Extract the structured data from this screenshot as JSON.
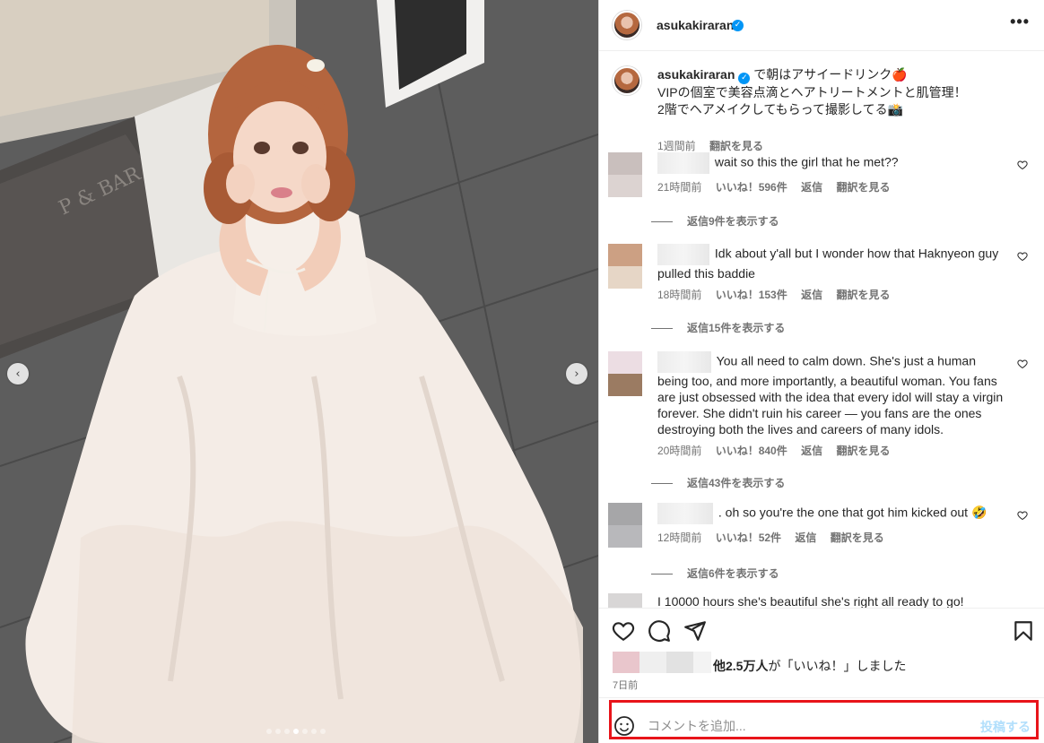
{
  "post": {
    "username": "asukakiraran",
    "verified_badge": "✓",
    "more_icon": "•••",
    "photo_nav": {
      "prev_icon": "‹",
      "next_icon": "›",
      "dot_count": 7,
      "active_dot": 3
    }
  },
  "caption": {
    "username": "asukakiraran",
    "lines": [
      "で朝はアサイードリンク🍎",
      "VIPの個室で美容点滴とヘアトリートメントと肌管理！",
      "2階でヘアメイクしてもらって撮影してる📸"
    ],
    "time": "1週間前",
    "translate": "翻訳を見る"
  },
  "comments": [
    {
      "text": "wait so this the girl that he met??",
      "time": "21時間前",
      "likes": "いいね！596件",
      "reply": "返信",
      "translate": "翻訳を見る",
      "view_replies": "返信9件を表示する"
    },
    {
      "text": "Idk about y'all but I wonder how that Haknyeon guy pulled this baddie",
      "time": "18時間前",
      "likes": "いいね！153件",
      "reply": "返信",
      "translate": "翻訳を見る",
      "view_replies": "返信15件を表示する"
    },
    {
      "text": "You all need to calm down. She's just a human being too, and more importantly, a beautiful woman. You fans are just obsessed with the idea that every idol will stay a virgin forever. She didn't ruin his career — you fans are the ones destroying both the lives and careers of many idols.",
      "time": "20時間前",
      "likes": "いいね！840件",
      "reply": "返信",
      "translate": "翻訳を見る",
      "view_replies": "返信43件を表示する"
    },
    {
      "text": ". oh so you're the one that got him kicked out 🤣",
      "time": "12時間前",
      "likes": "いいね！52件",
      "reply": "返信",
      "translate": "翻訳を見る",
      "view_replies": "返信6件を表示する"
    },
    {
      "text": "I 10000 hours she's beautiful she's right all ready to go!"
    }
  ],
  "actions": {
    "like_icon": "heart-icon",
    "comment_icon": "comment-icon",
    "share_icon": "share-icon",
    "save_icon": "bookmark-icon",
    "likes_bold": "他2.5万人",
    "likes_rest": "が「いいね！」しました",
    "date": "7日前"
  },
  "comment_box": {
    "placeholder": "コメントを追加...",
    "post_label": "投稿する",
    "highlight_color": "#e8141a"
  }
}
